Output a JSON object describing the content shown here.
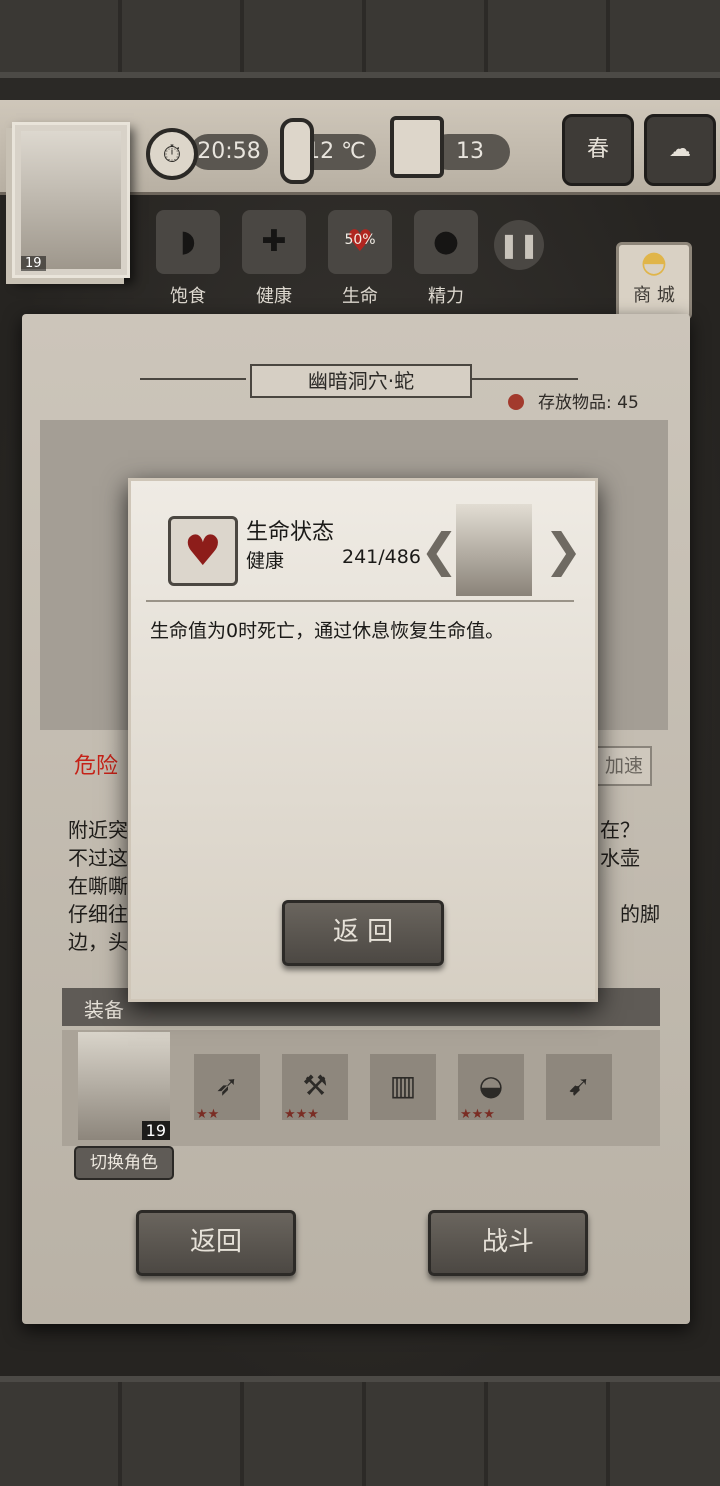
{
  "status_bar": {
    "time": "20:58",
    "temperature": "12 ℃",
    "day": "13",
    "season": "春",
    "level": "19"
  },
  "stats": [
    {
      "label": "饱食",
      "icon": "stomach-icon"
    },
    {
      "label": "健康",
      "icon": "plus-icon"
    },
    {
      "label": "生命",
      "icon": "heart-icon",
      "value": "50%"
    },
    {
      "label": "精力",
      "icon": "person-icon"
    }
  ],
  "shop_label": "商 城",
  "location": {
    "title": "幽暗洞穴·蛇",
    "storage_label": "存放物品: 45"
  },
  "danger_label": "危险",
  "speed_label": "加速",
  "story_fragments": [
    {
      "left": "附近突",
      "right": "在？"
    },
    {
      "left": "不过这",
      "right": "水壶"
    },
    {
      "left": "在嘶嘶",
      "right": ""
    },
    {
      "left": "仔细往",
      "right": "的脚"
    },
    {
      "left": "边，头",
      "right": ""
    }
  ],
  "equipment": {
    "header": "装备",
    "level": "19",
    "switch_label": "切换角色",
    "slots": [
      {
        "icon": "crossbow-icon",
        "stars": "★★"
      },
      {
        "icon": "axe-icon",
        "stars": "★★★"
      },
      {
        "icon": "vest-icon",
        "stars": ""
      },
      {
        "icon": "helmet-icon",
        "stars": "★★★"
      },
      {
        "icon": "arrows-icon",
        "stars": ""
      }
    ]
  },
  "buttons": {
    "back": "返回",
    "fight": "战斗"
  },
  "modal": {
    "title": "生命状态",
    "subtitle": "健康",
    "value": "241/486",
    "description": "生命值为0时死亡，通过休息恢复生命值。",
    "back": "返 回"
  },
  "colors": {
    "danger": "#c52218",
    "heart": "#8d1d1a"
  }
}
